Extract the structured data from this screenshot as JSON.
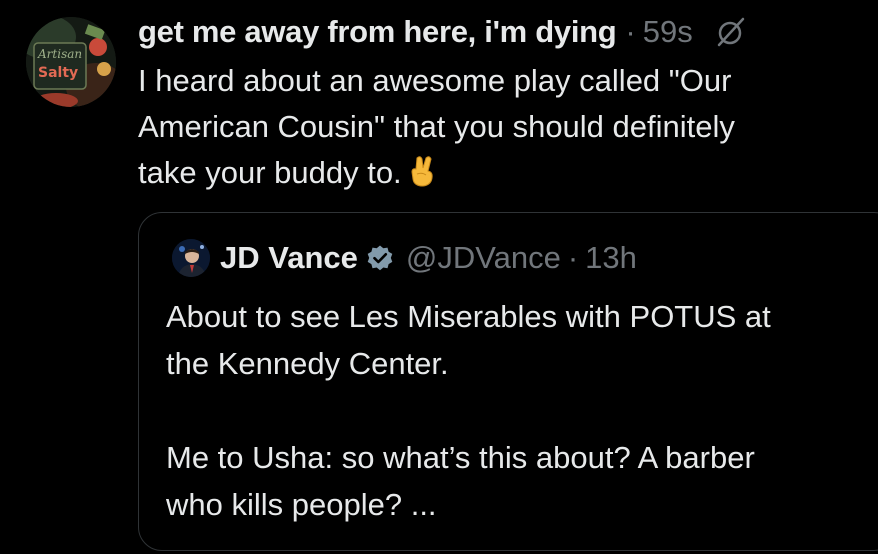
{
  "post": {
    "display_name": "get me away from here, i'm dying",
    "time": "59s",
    "lines": [
      "I heard about an awesome play called \"Our",
      "American Cousin\" that you should definitely",
      "take your buddy to."
    ],
    "emoji": "crossed-fingers",
    "grok_icon": "slashed-circle-icon",
    "avatar": {
      "sign_text_top": "Artisan",
      "sign_text_bottom": "Salty"
    }
  },
  "quote": {
    "display_name": "JD Vance",
    "handle": "@JDVance",
    "time": "13h",
    "lines_para1": [
      "About to see Les Miserables with POTUS at",
      "the Kennedy Center."
    ],
    "lines_para2": [
      "Me to Usha: so what’s this about? A barber",
      "who kills people? ..."
    ],
    "verified_color": "#829aab"
  },
  "colors": {
    "background": "#000000",
    "text": "#e7e9ea",
    "muted": "#71767b",
    "border": "#2f3336"
  }
}
